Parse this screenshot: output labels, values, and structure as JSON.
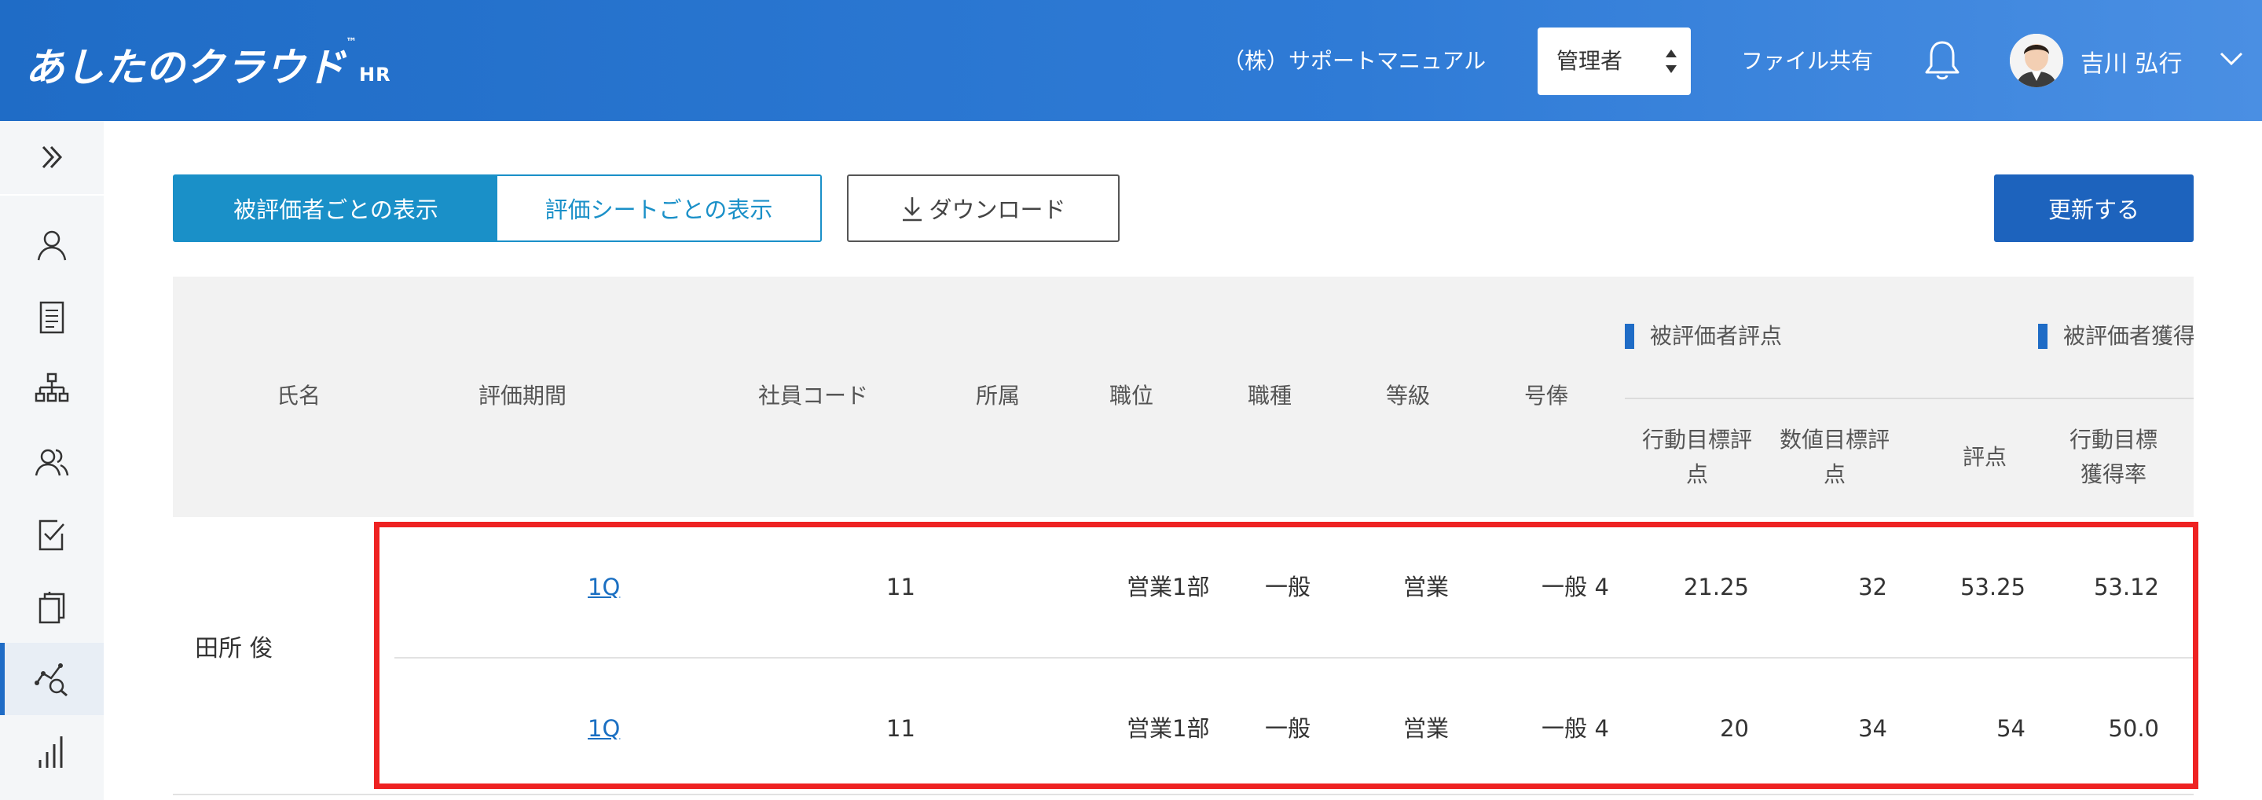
{
  "header": {
    "logo": "あしたのクラウド",
    "logo_tm": "™",
    "logo_suffix": "HR",
    "company": "（株）サポートマニュアル",
    "role_selected": "管理者",
    "file_share": "ファイル共有",
    "user_name": "吉川 弘行"
  },
  "toolbar": {
    "tab_by_evaluatee": "被評価者ごとの表示",
    "tab_by_sheet": "評価シートごとの表示",
    "download": "ダウンロード",
    "update": "更新する"
  },
  "table": {
    "headers": {
      "name": "氏名",
      "period": "評価期間",
      "employee_code": "社員コード",
      "department": "所属",
      "position": "職位",
      "job_type": "職種",
      "grade": "等級",
      "salary_step": "号俸"
    },
    "group_scores": "被評価者評点",
    "group_rates": "被評価者獲得",
    "sub_headers": {
      "behavior_score_1": "行動目標評",
      "behavior_score_2": "点",
      "numeric_score_1": "数値目標評",
      "numeric_score_2": "点",
      "score": "評点",
      "behavior_rate_1": "行動目標",
      "behavior_rate_2": "獲得率"
    },
    "employee_name": "田所 俊",
    "rows": [
      {
        "period": "1Q",
        "employee_code": "11",
        "department": "営業1部",
        "position": "一般",
        "job_type": "営業",
        "grade": "一般",
        "salary_step": "4",
        "behavior_score": "21.25",
        "numeric_score": "32",
        "score": "53.25",
        "behavior_rate": "53.12"
      },
      {
        "period": "1Q",
        "employee_code": "11",
        "department": "営業1部",
        "position": "一般",
        "job_type": "営業",
        "grade": "一般",
        "salary_step": "4",
        "behavior_score": "20",
        "numeric_score": "34",
        "score": "54",
        "behavior_rate": "50.0"
      }
    ]
  },
  "colors": {
    "header_blue": "#1f6cc6",
    "tab_active": "#1a90c8",
    "update_button": "#1d63bd",
    "highlight_red": "#ee2222",
    "link_blue": "#1a6fc2"
  }
}
